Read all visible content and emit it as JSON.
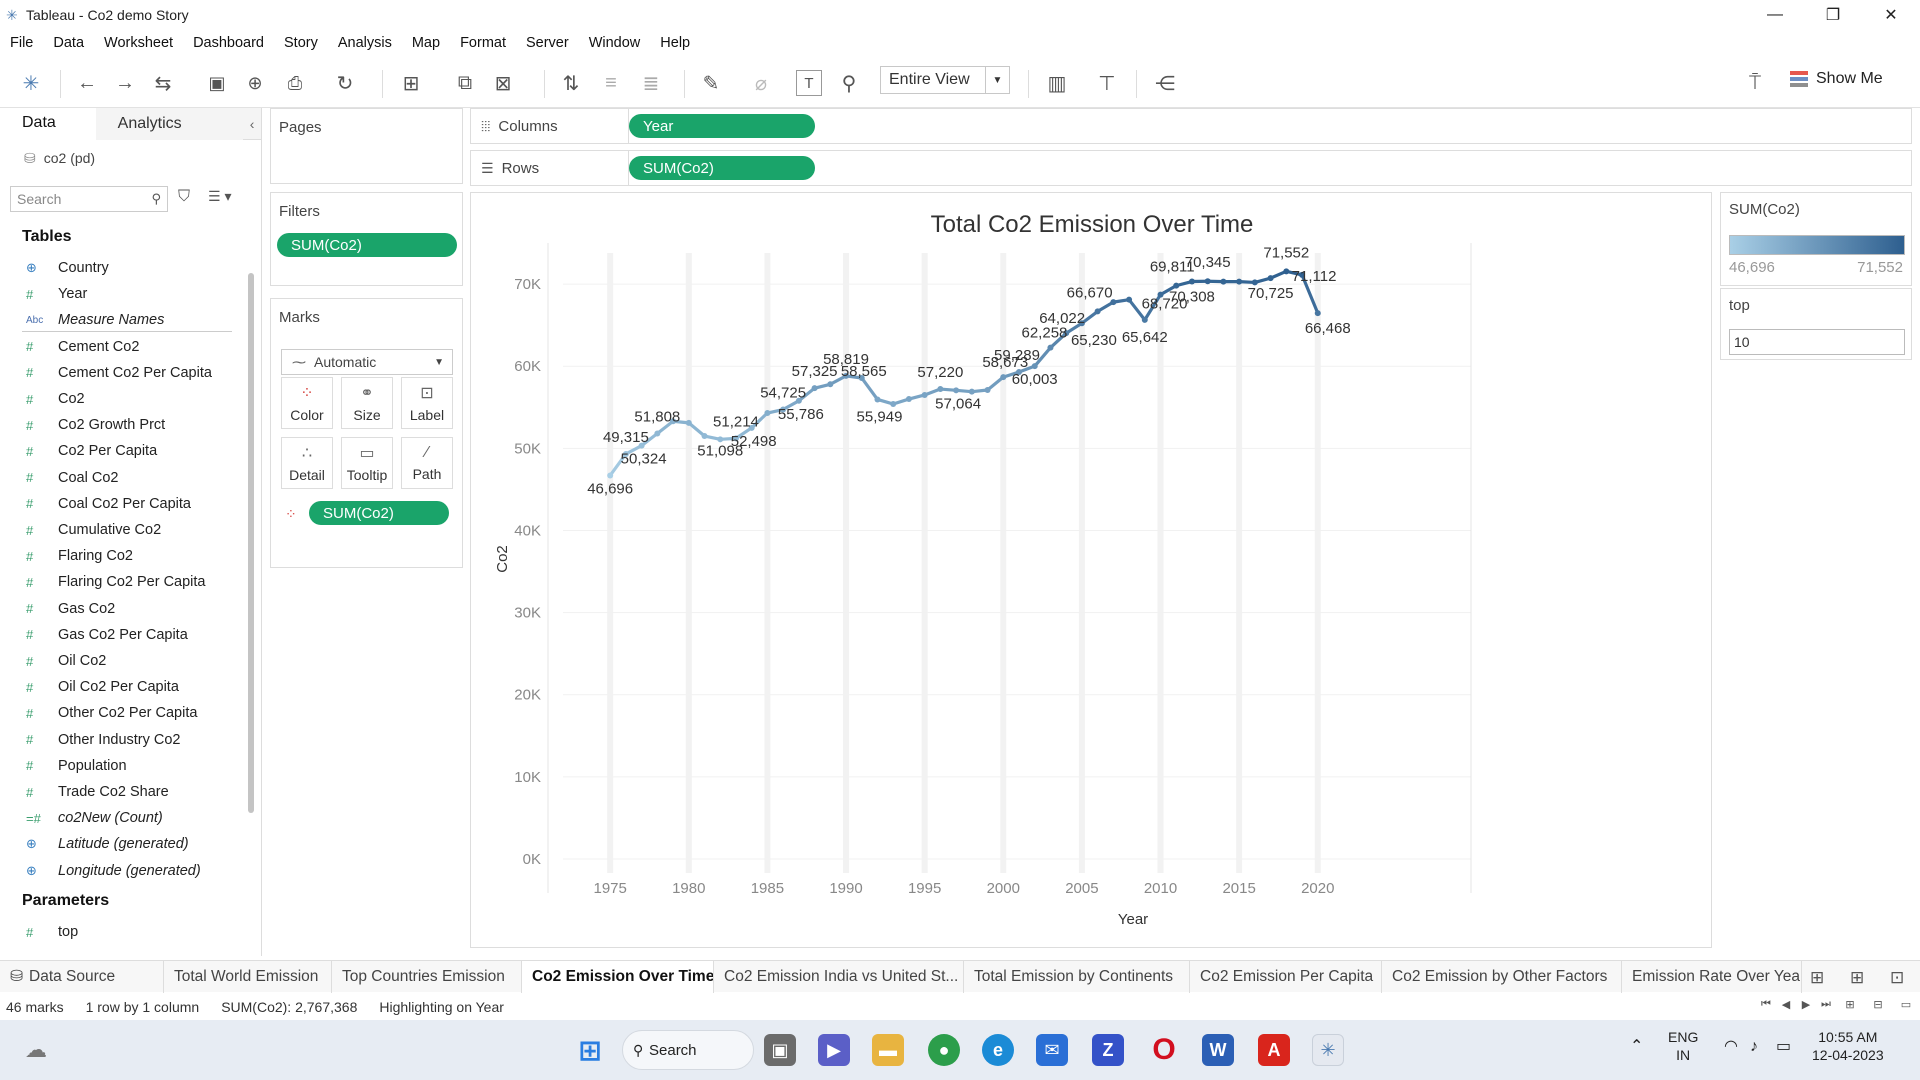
{
  "window": {
    "title": "Tableau - Co2 demo Story",
    "minimize": "—",
    "maximize": "❐",
    "close": "✕"
  },
  "menu": [
    "File",
    "Data",
    "Worksheet",
    "Dashboard",
    "Story",
    "Analysis",
    "Map",
    "Format",
    "Server",
    "Window",
    "Help"
  ],
  "toolbar": {
    "view_select": "Entire View",
    "show_me": "Show Me"
  },
  "data_pane": {
    "tab_data": "Data",
    "tab_analytics": "Analytics",
    "source": "co2 (pd)",
    "search_placeholder": "Search",
    "tables_heading": "Tables",
    "fields": [
      {
        "icon": "globe",
        "label": "Country",
        "italic": false
      },
      {
        "icon": "#",
        "label": "Year",
        "italic": false
      },
      {
        "icon": "Abc",
        "label": "Measure Names",
        "italic": true
      },
      {
        "icon": "#",
        "label": "Cement Co2",
        "italic": false
      },
      {
        "icon": "#",
        "label": "Cement Co2 Per Capita",
        "italic": false
      },
      {
        "icon": "#",
        "label": "Co2",
        "italic": false
      },
      {
        "icon": "#",
        "label": "Co2 Growth Prct",
        "italic": false
      },
      {
        "icon": "#",
        "label": "Co2 Per Capita",
        "italic": false
      },
      {
        "icon": "#",
        "label": "Coal Co2",
        "italic": false
      },
      {
        "icon": "#",
        "label": "Coal Co2 Per Capita",
        "italic": false
      },
      {
        "icon": "#",
        "label": "Cumulative Co2",
        "italic": false
      },
      {
        "icon": "#",
        "label": "Flaring Co2",
        "italic": false
      },
      {
        "icon": "#",
        "label": "Flaring Co2 Per Capita",
        "italic": false
      },
      {
        "icon": "#",
        "label": "Gas Co2",
        "italic": false
      },
      {
        "icon": "#",
        "label": "Gas Co2 Per Capita",
        "italic": false
      },
      {
        "icon": "#",
        "label": "Oil Co2",
        "italic": false
      },
      {
        "icon": "#",
        "label": "Oil Co2 Per Capita",
        "italic": false
      },
      {
        "icon": "#",
        "label": "Other Co2 Per Capita",
        "italic": false
      },
      {
        "icon": "#",
        "label": "Other Industry Co2",
        "italic": false
      },
      {
        "icon": "#",
        "label": "Population",
        "italic": false
      },
      {
        "icon": "#",
        "label": "Trade Co2 Share",
        "italic": false
      },
      {
        "icon": "=#",
        "label": "co2New (Count)",
        "italic": true
      },
      {
        "icon": "globe",
        "label": "Latitude (generated)",
        "italic": true
      },
      {
        "icon": "globe",
        "label": "Longitude (generated)",
        "italic": true
      }
    ],
    "parameters_heading": "Parameters",
    "parameters": [
      {
        "icon": "#",
        "label": "top"
      }
    ]
  },
  "pages": {
    "title": "Pages"
  },
  "filters": {
    "title": "Filters",
    "pill": "SUM(Co2)"
  },
  "marks": {
    "title": "Marks",
    "type": "Automatic",
    "buttons": [
      "Color",
      "Size",
      "Label",
      "Detail",
      "Tooltip",
      "Path"
    ],
    "pill": "SUM(Co2)"
  },
  "shelves": {
    "columns_label": "Columns",
    "columns_pill": "Year",
    "rows_label": "Rows",
    "rows_pill": "SUM(Co2)"
  },
  "legend": {
    "title": "SUM(Co2)",
    "min": "46,696",
    "max": "71,552",
    "color_min": "#a9cfe6",
    "color_max": "#2e5f8f"
  },
  "parameter_card": {
    "title": "top",
    "value": "10"
  },
  "chart_data": {
    "type": "line",
    "title": "Total Co2 Emission Over Time",
    "xlabel": "Year",
    "ylabel": "Co2",
    "xlim": [
      1972,
      2030
    ],
    "ylim": [
      0,
      75000
    ],
    "x_ticks": [
      "1975",
      "1980",
      "1985",
      "1990",
      "1995",
      "2000",
      "2005",
      "2010",
      "2015",
      "2020"
    ],
    "y_ticks": [
      "0K",
      "10K",
      "20K",
      "30K",
      "40K",
      "50K",
      "60K",
      "70K"
    ],
    "grid": "vertical",
    "series": [
      {
        "x": [
          1975,
          1976,
          1977,
          1978,
          1979,
          1980,
          1981,
          1982,
          1983,
          1984,
          1985,
          1986,
          1987,
          1988,
          1989,
          1990,
          1991,
          1992,
          1993,
          1994,
          1995,
          1996,
          1997,
          1998,
          1999,
          2000,
          2001,
          2002,
          2003,
          2004,
          2005,
          2006,
          2007,
          2008,
          2009,
          2010,
          2011,
          2012,
          2013,
          2014,
          2015,
          2016,
          2017,
          2018,
          2019,
          2020
        ],
        "values": [
          46696,
          49315,
          50324,
          51808,
          53300,
          53100,
          51500,
          51098,
          51214,
          52498,
          54300,
          54725,
          55786,
          57325,
          57800,
          58819,
          58565,
          55949,
          55400,
          56000,
          56500,
          57220,
          57064,
          56900,
          57100,
          58673,
          59289,
          60003,
          62258,
          64022,
          65230,
          66670,
          67800,
          68100,
          65642,
          68720,
          69811,
          70308,
          70345,
          70300,
          70300,
          70200,
          70725,
          71552,
          71112,
          66468
        ],
        "labels": {
          "1975": "46,696",
          "1976": "49,315",
          "1977": "50,324",
          "1978": "51,808",
          "1982": "51,098",
          "1983": "51,214",
          "1984": "52,498",
          "1986": "54,725",
          "1987": "55,786",
          "1988": "57,325",
          "1990": "58,819",
          "1991": "58,565",
          "1992": "55,949",
          "1996": "57,220",
          "1997": "57,064",
          "2000": "58,673",
          "2001": "59,289",
          "2002": "60,003",
          "2003": "62,258",
          "2004": "64,022",
          "2005": "65,230",
          "2006": "66,670",
          "2009": "65,642",
          "2010": "68,720",
          "2011": "69,811",
          "2012": "70,308",
          "2013": "70,345",
          "2017": "70,725",
          "2018": "71,552",
          "2019": "71,112",
          "2020": "66,468"
        },
        "color_low": "#a9cfe6",
        "color_high": "#2e5f8f"
      }
    ]
  },
  "sheet_tabs": [
    "Data Source",
    "Total World Emission",
    "Top Countries Emission",
    "Co2 Emission Over Time",
    "Co2 Emission India vs United St...",
    "Total Emission by Continents",
    "Co2 Emission Per Capita",
    "Co2 Emission by Other Factors",
    "Emission Rate Over Years"
  ],
  "active_tab": "Co2 Emission Over Time",
  "status": {
    "marks": "46 marks",
    "rows": "1 row by 1 column",
    "sum": "SUM(Co2): 2,767,368",
    "highlight": "Highlighting on Year"
  },
  "taskbar": {
    "search": "Search",
    "lang": "ENG",
    "region": "IN",
    "time": "10:55 AM",
    "date": "12-04-2023"
  }
}
